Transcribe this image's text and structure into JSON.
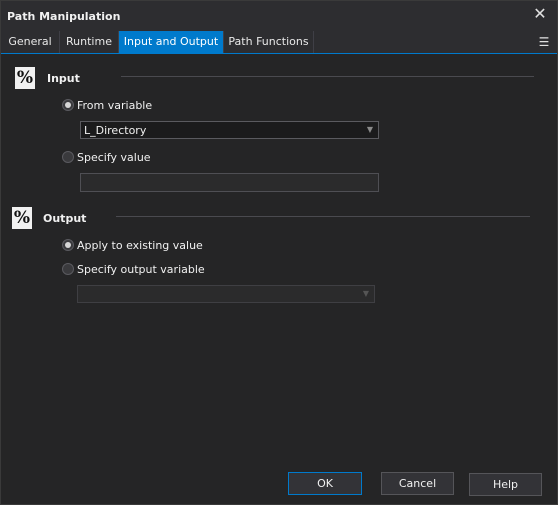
{
  "window": {
    "title": "Path Manipulation",
    "close_glyph": "✕"
  },
  "tabs": [
    {
      "label": "General"
    },
    {
      "label": "Runtime"
    },
    {
      "label": "Input and Output",
      "active": true
    },
    {
      "label": "Path Functions"
    }
  ],
  "tab_menu_glyph": "☰",
  "input_section": {
    "icon": "%",
    "label": "Input",
    "from_variable_label": "From variable",
    "from_variable_checked": true,
    "variable_value": "L_Directory",
    "specify_value_label": "Specify value",
    "specify_value_checked": false,
    "specify_value_text": ""
  },
  "output_section": {
    "icon": "%",
    "label": "Output",
    "apply_existing_label": "Apply to existing value",
    "apply_existing_checked": true,
    "specify_output_label": "Specify output variable",
    "specify_output_checked": false,
    "output_variable_value": ""
  },
  "buttons": {
    "ok": "OK",
    "cancel": "Cancel",
    "help": "Help"
  },
  "colors": {
    "accent": "#007acc",
    "background": "#252526",
    "titlebar": "#2d2d30"
  }
}
